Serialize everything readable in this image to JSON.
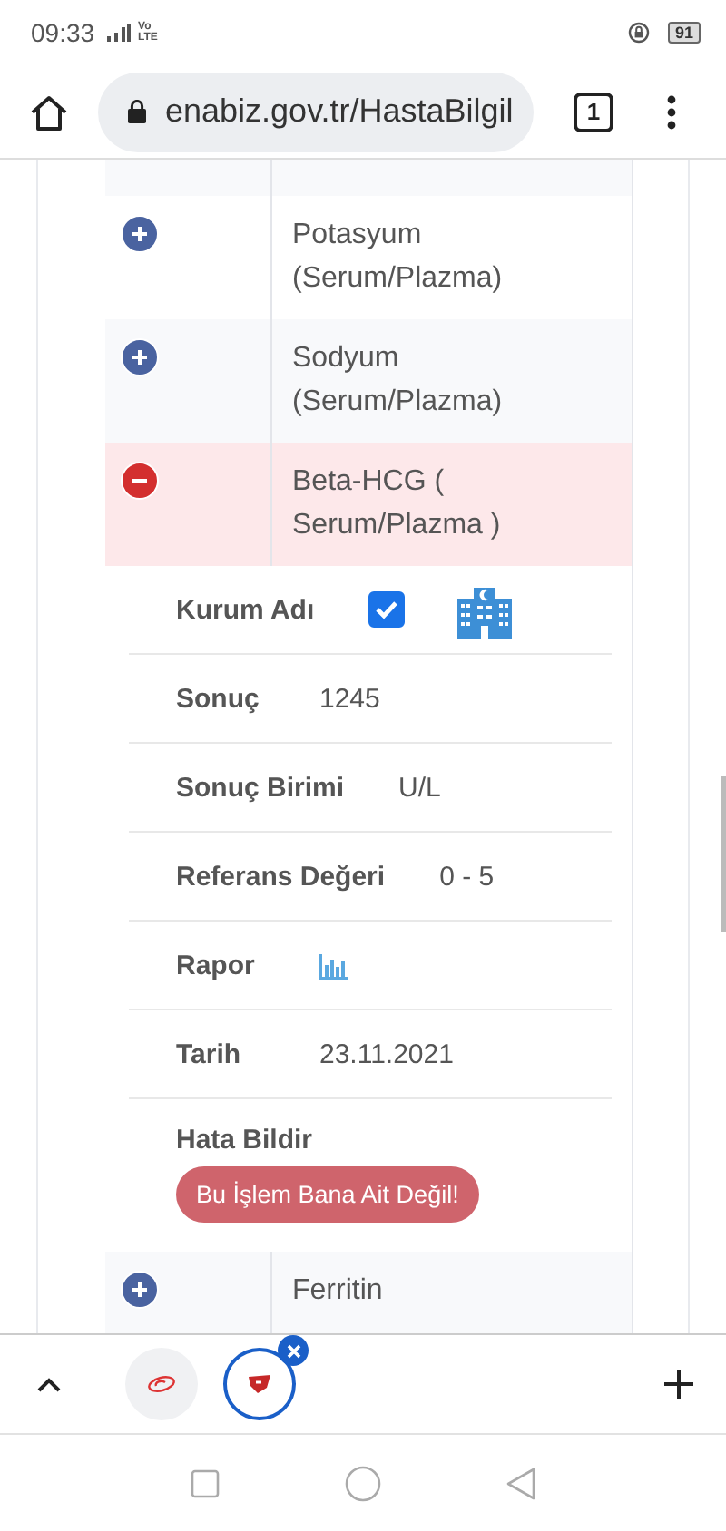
{
  "status_bar": {
    "time": "09:33",
    "network": "Vo LTE",
    "battery": "91"
  },
  "browser": {
    "url": "enabiz.gov.tr/HastaBilgil",
    "tab_count": "1"
  },
  "tests": [
    {
      "name": "Potasyum (Serum/Plazma)",
      "expanded": false
    },
    {
      "name": "Sodyum (Serum/Plazma)",
      "expanded": false
    },
    {
      "name": "Beta-HCG ( Serum/Plazma )",
      "expanded": true
    },
    {
      "name": "Ferritin",
      "expanded": false
    }
  ],
  "details": [
    {
      "kind": "check",
      "label": "Kurum Adı",
      "checked": true
    },
    {
      "kind": "text",
      "label": "Sonuç",
      "value": "1245"
    },
    {
      "kind": "text",
      "label": "Sonuç Birimi",
      "value": "U/L"
    },
    {
      "kind": "text",
      "label": "Referans Değeri",
      "value": "0 - 5"
    },
    {
      "kind": "report",
      "label": "Rapor"
    },
    {
      "kind": "text",
      "label": "Tarih",
      "value": "23.11.2021"
    }
  ],
  "error_report": {
    "label": "Hata Bildir",
    "button": "Bu İşlem Bana Ait Değil!"
  },
  "tabs": [
    {
      "selected": false
    },
    {
      "selected": true
    }
  ]
}
